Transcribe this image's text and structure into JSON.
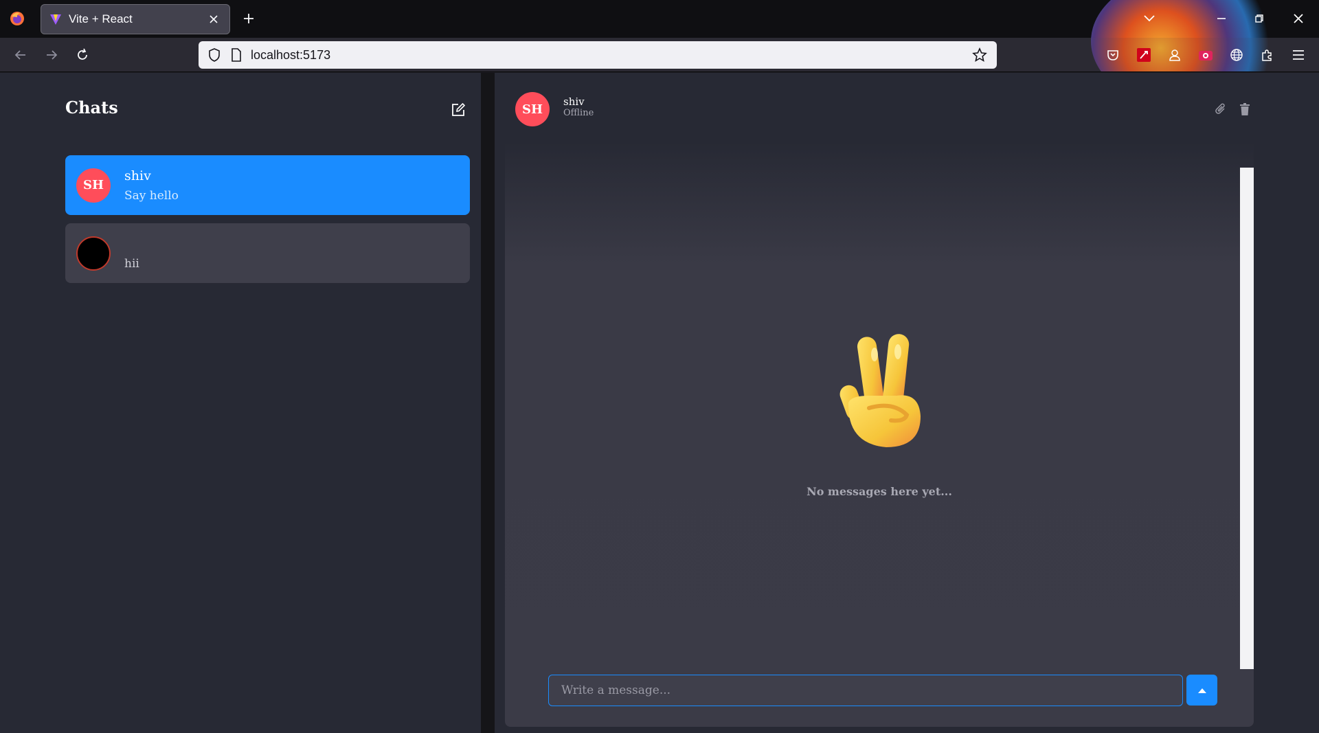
{
  "browser": {
    "tab_title": "Vite + React",
    "url": "localhost:5173"
  },
  "icons": {
    "browser_logo": "firefox-logo-icon",
    "favicon": "vite-favicon-icon",
    "back": "arrow-left-icon",
    "forward": "arrow-right-icon",
    "reload": "reload-icon",
    "shield": "shield-icon",
    "page": "page-icon",
    "bookmark": "star-icon",
    "extensions": [
      "pocket-icon",
      "extension-red-icon",
      "account-icon",
      "screenshot-icon",
      "globe-icon",
      "puzzle-icon",
      "menu-icon"
    ],
    "compose": "compose-icon",
    "attach": "paperclip-icon",
    "delete": "trash-icon",
    "send": "caret-up-icon",
    "empty_state": "victory-hand-emoji"
  },
  "colors": {
    "accent": "#1a8cff",
    "avatar_red": "#ff4d5a",
    "panel": "#272934",
    "card": "#3f3f4b"
  },
  "sidebar": {
    "title": "Chats",
    "chats": [
      {
        "initials": "SH",
        "name": "shiv",
        "preview": "Say hello",
        "active": true
      },
      {
        "initials": "",
        "name": "",
        "preview": "hii",
        "active": false
      }
    ]
  },
  "conversation": {
    "initials": "SH",
    "name": "shiv",
    "status": "Offline",
    "empty_message": "No messages here yet...",
    "input_placeholder": "Write a message...",
    "input_value": ""
  }
}
